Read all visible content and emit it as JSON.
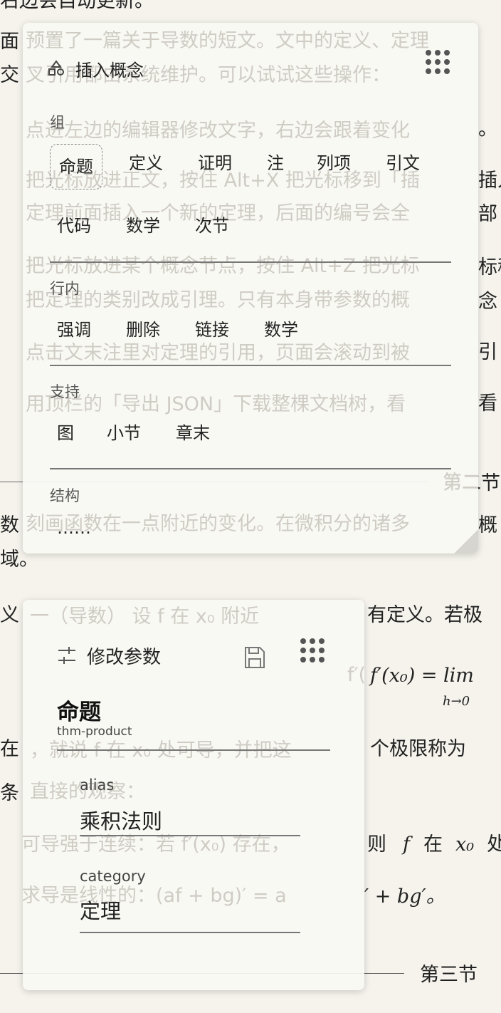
{
  "background": {
    "lines": [
      {
        "text": "右边会自动更新。"
      },
      {
        "text": "面"
      },
      {
        "text": "交"
      },
      {
        "text": "。"
      },
      {
        "text": "插入"
      },
      {
        "text": "部"
      },
      {
        "text": "标移"
      },
      {
        "text": "念"
      },
      {
        "text": "引"
      },
      {
        "text": "看"
      },
      {
        "text": "第二节"
      },
      {
        "text": "数"
      },
      {
        "text": "概"
      },
      {
        "text": "域。"
      },
      {
        "text": "义"
      },
      {
        "text": "有定义。若极"
      },
      {
        "text": "在"
      },
      {
        "text": "个极限称为"
      },
      {
        "text": "条"
      },
      {
        "text": "则"
      },
      {
        "text": "在"
      },
      {
        "text": "处"
      },
      {
        "text": "′ + bg′。"
      },
      {
        "text": "第三节"
      }
    ],
    "math_formula": "f′(x₀) = lim",
    "math_sub": "h→0",
    "faint_text_top": [
      "预置了一篇关于导数的短文。文中的定义、定理",
      "叉引用都由系统维护。可以试试这些操作：",
      "点进左边的编辑器修改文字，右边会跟着变化",
      "把光标放进正文，按住 Alt+X 把光标移到「插",
      "定理前面插入一个新的定理，后面的编号会全",
      "把光标放进某个概念节点，按住 Alt+Z 把光标",
      "把定理的类别改成引理。只有本身带参数的概",
      "点击文末注里对定理的引用，页面会滚动到被",
      "用顶栏的「导出 JSON」下载整棵文档树，看",
      "第二节",
      "刻画函数在一点附近的变化。在微积分的诸多"
    ],
    "faint_text_bottom": [
      "一（导数） 设 f 在 x₀ 附近",
      "f′(x₀) = lim",
      "，就说 f 在 x₀ 处可导，并把这",
      "直接的观察：",
      "可导强于连续：若 f′(x₀) 存在，",
      "求导是线性的：(af + bg)′ = a"
    ]
  },
  "insert_panel": {
    "title": "插入概念",
    "icon": "concept-icon",
    "groups": [
      {
        "label": "组",
        "items": [
          "命题",
          "定义",
          "证明",
          "注",
          "列项",
          "引文",
          "代码",
          "数学",
          "次节"
        ],
        "selected": "命题"
      },
      {
        "label": "行内",
        "items": [
          "强调",
          "删除",
          "链接",
          "数学"
        ]
      },
      {
        "label": "支持",
        "items": [
          "图",
          "小节",
          "章末"
        ]
      },
      {
        "label": "结构",
        "items": [
          "……"
        ]
      }
    ]
  },
  "edit_panel": {
    "title": "修改参数",
    "icon": "sliders-icon",
    "save_icon": "save-icon",
    "concept_name": "命题",
    "concept_id": "thm-product",
    "fields": [
      {
        "label": "alias",
        "value": "乘积法则"
      },
      {
        "label": "category",
        "value": "定理"
      }
    ]
  }
}
